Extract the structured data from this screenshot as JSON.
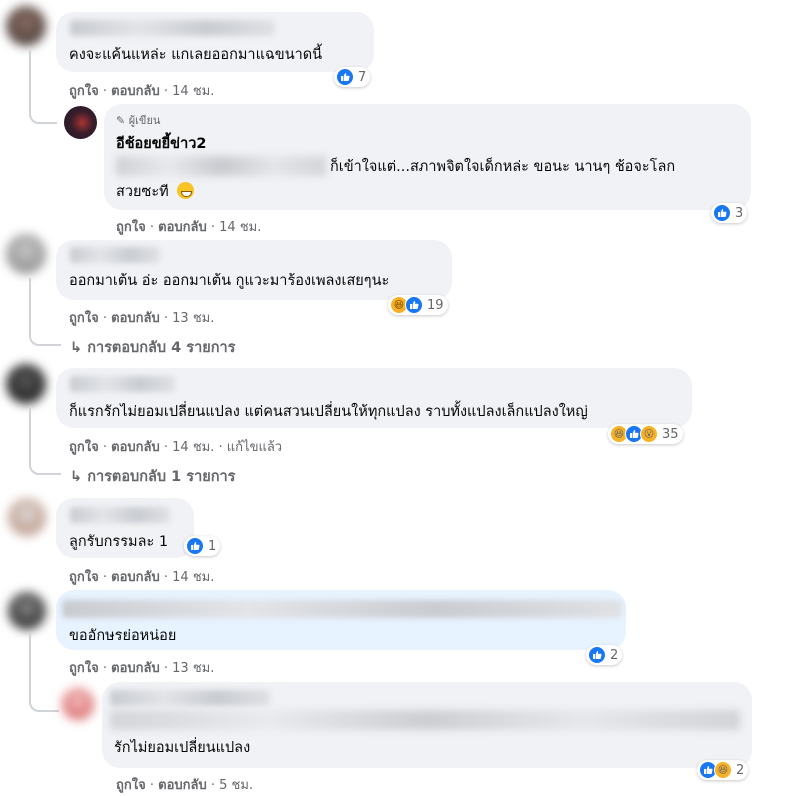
{
  "comments": [
    {
      "text": "คงจะแค้นแหล่ะ แกเลยออกมาแฉขนาดนี้",
      "like": "ถูกใจ",
      "reply": "ตอบกลับ",
      "time": "14 ชม.",
      "reactions": "7"
    },
    {
      "badge": "ผู้เขียน",
      "name": "อีช้อยขยี้ข่าว2",
      "line1_end": "ก็เข้าใจแต่...สภาพจิตใจเด็กหล่ะ ขอนะ นานๆ ช้อจะโลก",
      "line2": "สวยซะที",
      "like": "ถูกใจ",
      "reply": "ตอบกลับ",
      "time": "14 ชม.",
      "reactions": "3"
    },
    {
      "text": "ออกมาเต้น อ่ะ ออกมาเต้น กูแวะมาร้องเพลงเสยๆนะ",
      "like": "ถูกใจ",
      "reply": "ตอบกลับ",
      "time": "13 ชม.",
      "reactions": "19",
      "replies": "การตอบกลับ 4 รายการ"
    },
    {
      "text": "ก็แรกรักไม่ยอมเปลี่ยนแปลง แต่คนสวนเปลี่ยนให้ทุกแปลง ราบทั้งแปลงเล็กแปลงใหญ่",
      "like": "ถูกใจ",
      "reply": "ตอบกลับ",
      "time": "14 ชม.",
      "edited": "แก้ไขแล้ว",
      "reactions": "35",
      "replies": "การตอบกลับ 1 รายการ"
    },
    {
      "text": "ลูกรับกรรมละ 1",
      "like": "ถูกใจ",
      "reply": "ตอบกลับ",
      "time": "14 ชม.",
      "reactions": "1"
    },
    {
      "text": "ขออักษรย่อหน่อย",
      "like": "ถูกใจ",
      "reply": "ตอบกลับ",
      "time": "13 ชม.",
      "reactions": "2"
    },
    {
      "text": "รักไม่ยอมเปลี่ยนแปลง",
      "like": "ถูกใจ",
      "reply": "ตอบกลับ",
      "time": "5 ชม.",
      "reactions": "2"
    }
  ],
  "separator": "·",
  "icons": {
    "like": "thumbs-up-icon",
    "haha": "laughing-face-icon",
    "wow": "surprised-face-icon",
    "grin": "grinning-emoji",
    "reply_arrow": "reply-arrow-icon",
    "pencil": "pencil-icon"
  },
  "colors": {
    "like": "#1877f2",
    "haha": "#f7b125",
    "bubble": "#f0f2f5",
    "meta": "#65676b"
  }
}
